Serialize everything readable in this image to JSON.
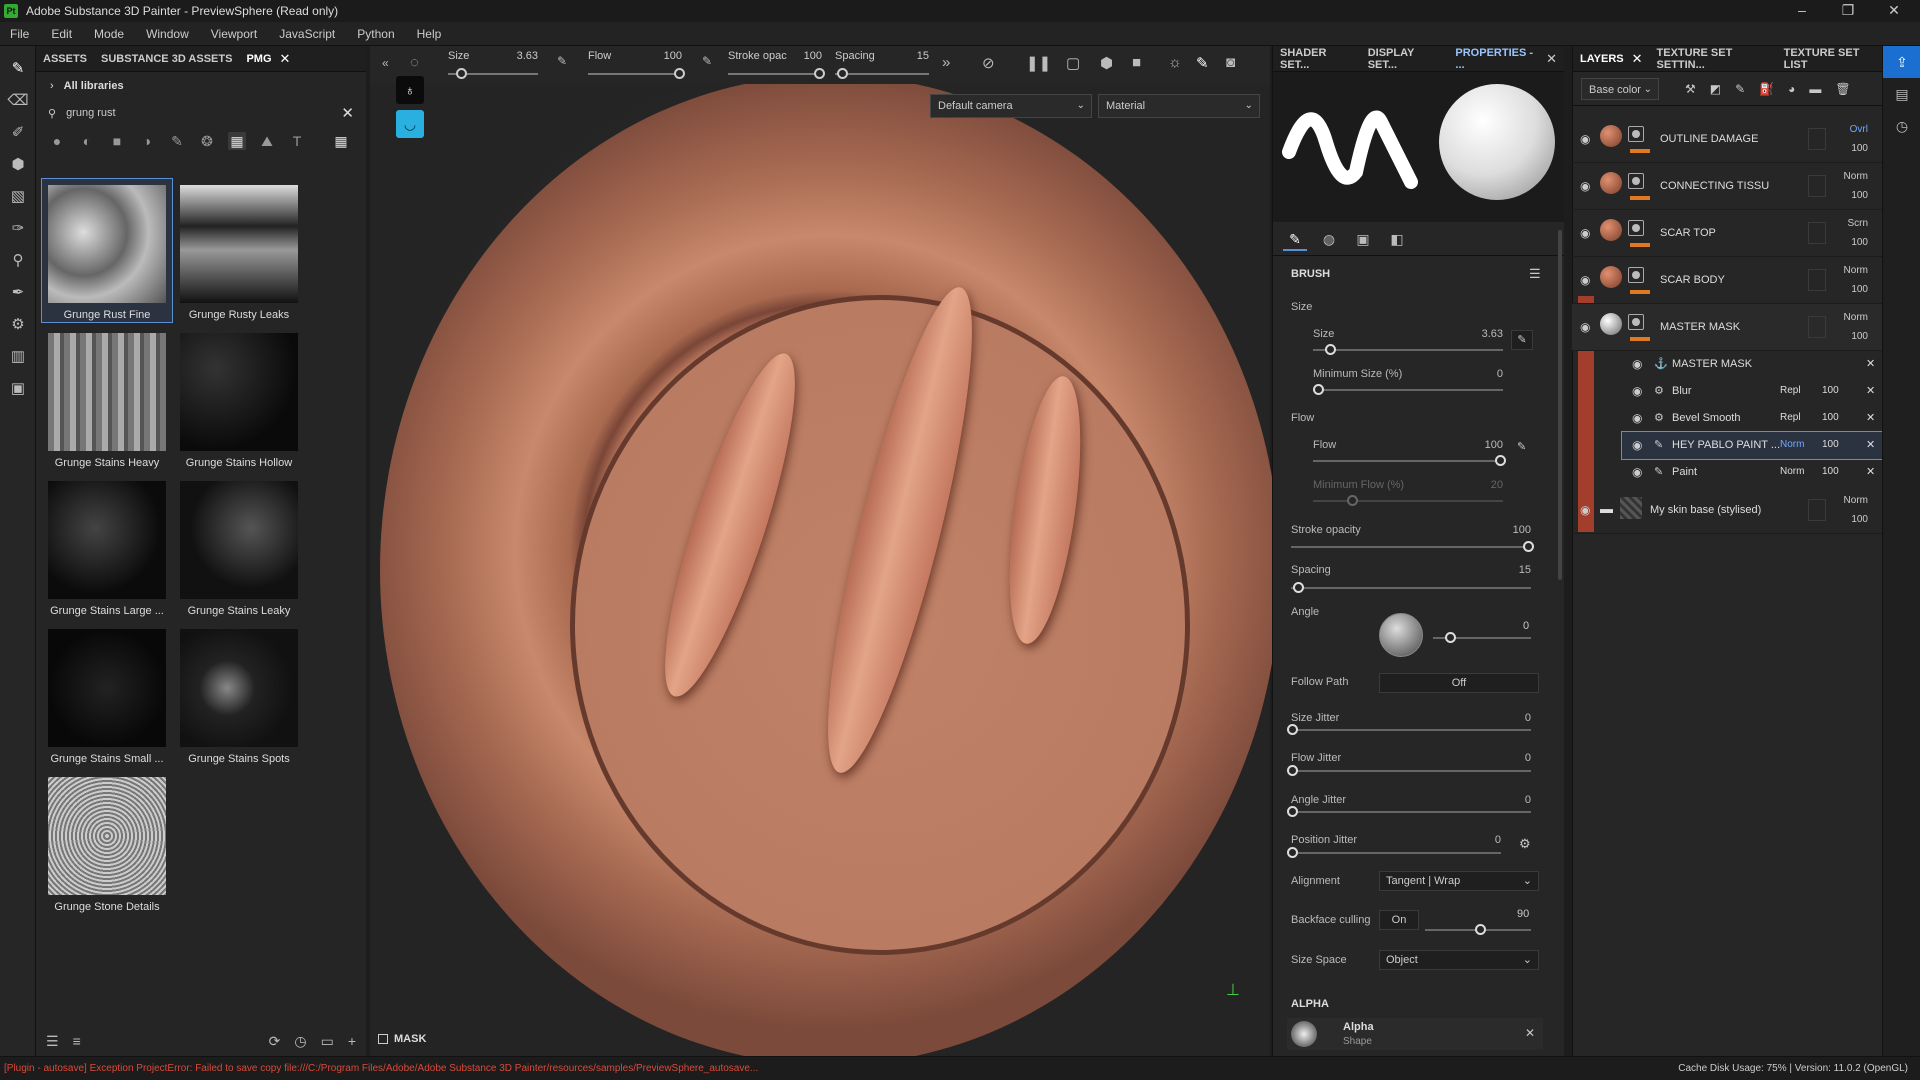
{
  "window": {
    "title": "Adobe Substance 3D Painter - PreviewSphere (Read only)",
    "logo": "Pt"
  },
  "menu": [
    "File",
    "Edit",
    "Mode",
    "Window",
    "Viewport",
    "JavaScript",
    "Python",
    "Help"
  ],
  "assets": {
    "tabs": [
      "ASSETS",
      "SUBSTANCE 3D ASSETS",
      "PMG"
    ],
    "library": "All libraries",
    "search_value": "grung rust",
    "items": [
      {
        "label": "Grunge Rust Fine"
      },
      {
        "label": "Grunge Rusty Leaks"
      },
      {
        "label": "Grunge Stains Heavy"
      },
      {
        "label": "Grunge Stains Hollow"
      },
      {
        "label": "Grunge Stains Large ..."
      },
      {
        "label": "Grunge Stains Leaky"
      },
      {
        "label": "Grunge Stains Small ..."
      },
      {
        "label": "Grunge Stains Spots"
      },
      {
        "label": "Grunge Stone Details"
      }
    ]
  },
  "viewport": {
    "size_label": "Size",
    "size_value": "3.63",
    "flow_label": "Flow",
    "flow_value": "100",
    "stroke_label": "Stroke opac",
    "stroke_value": "100",
    "spacing_label": "Spacing",
    "spacing_value": "15",
    "camera": "Default camera",
    "mode": "Material",
    "mask_label": "MASK"
  },
  "props": {
    "tabs": [
      "SHADER SET...",
      "DISPLAY SET...",
      "PROPERTIES - ..."
    ],
    "brush_title": "BRUSH",
    "size_group": "Size",
    "size_label": "Size",
    "size_value": "3.63",
    "minsize_label": "Minimum Size (%)",
    "minsize_value": "0",
    "flow_group": "Flow",
    "flow_label": "Flow",
    "flow_value": "100",
    "minflow_label": "Minimum Flow (%)",
    "minflow_value": "20",
    "stroke_label": "Stroke opacity",
    "stroke_value": "100",
    "spacing_label": "Spacing",
    "spacing_value": "15",
    "angle_label": "Angle",
    "angle_value": "0",
    "follow_label": "Follow Path",
    "follow_value": "Off",
    "sizejit_label": "Size Jitter",
    "sizejit_value": "0",
    "flowjit_label": "Flow Jitter",
    "flowjit_value": "0",
    "anglejit_label": "Angle Jitter",
    "anglejit_value": "0",
    "posjit_label": "Position Jitter",
    "posjit_value": "0",
    "align_label": "Alignment",
    "align_value": "Tangent | Wrap",
    "backface_label": "Backface culling",
    "backface_value": "On",
    "backface_num": "90",
    "sizespace_label": "Size Space",
    "sizespace_value": "Object",
    "alpha_title": "ALPHA",
    "alpha_name": "Alpha",
    "alpha_sub": "Shape"
  },
  "layers": {
    "tabs": [
      "LAYERS",
      "TEXTURE SET SETTIN...",
      "TEXTURE SET LIST"
    ],
    "channel": "Base color",
    "rows": [
      {
        "name": "OUTLINE DAMAGE",
        "blend": "Ovrl",
        "opacity": "100"
      },
      {
        "name": "CONNECTING TISSU",
        "blend": "Norm",
        "opacity": "100"
      },
      {
        "name": "SCAR TOP",
        "blend": "Scrn",
        "opacity": "100"
      },
      {
        "name": "SCAR BODY",
        "blend": "Norm",
        "opacity": "100"
      },
      {
        "name": "MASTER MASK",
        "blend": "Norm",
        "opacity": "100"
      }
    ],
    "subs": [
      {
        "name": "MASTER MASK",
        "blend": "",
        "opacity": ""
      },
      {
        "name": "Blur",
        "blend": "Repl",
        "opacity": "100"
      },
      {
        "name": "Bevel Smooth",
        "blend": "Repl",
        "opacity": "100"
      },
      {
        "name": "HEY PABLO PAINT ...",
        "blend": "Norm",
        "opacity": "100"
      },
      {
        "name": "Paint",
        "blend": "Norm",
        "opacity": "100"
      }
    ],
    "folder": {
      "name": "My skin base (stylised)",
      "blend": "Norm",
      "opacity": "100"
    }
  },
  "status": {
    "error": "[Plugin - autosave] Exception ProjectError: Failed to save copy file:///C:/Program Files/Adobe/Adobe Substance 3D Painter/resources/samples/PreviewSphere_autosave...",
    "cache": "Cache Disk Usage:    75% | Version: 11.0.2 (OpenGL)"
  }
}
